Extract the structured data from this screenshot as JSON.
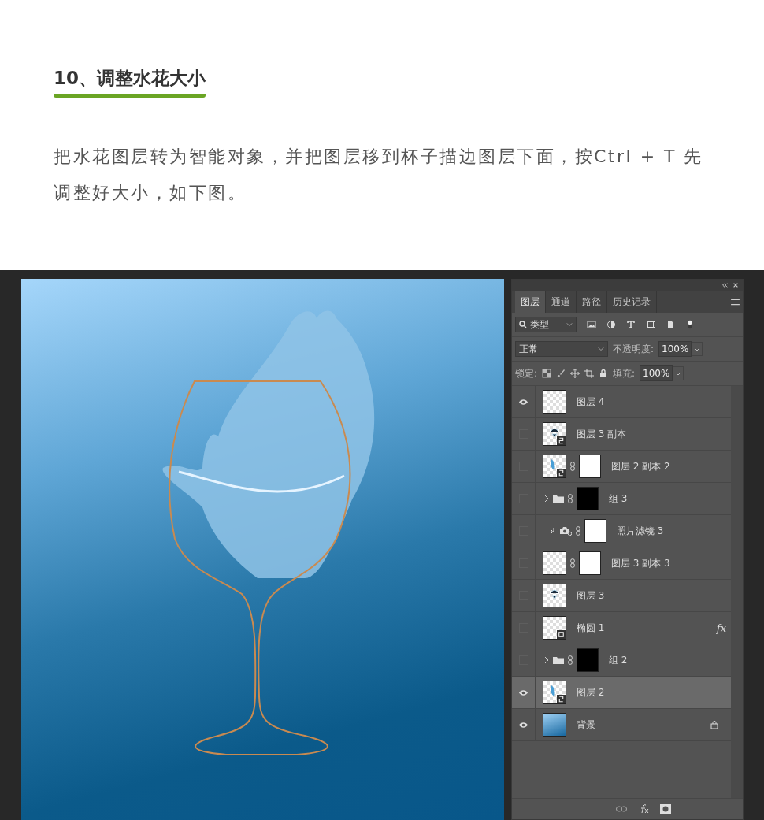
{
  "article": {
    "heading": "10、调整水花大小",
    "paragraph": "把水花图层转为智能对象，并把图层移到杯子描边图层下面，按Ctrl + T 先调整好大小，如下图。"
  },
  "panel": {
    "tabs": [
      {
        "label": "图层",
        "selected": true
      },
      {
        "label": "通道",
        "selected": false
      },
      {
        "label": "路径",
        "selected": false
      },
      {
        "label": "历史记录",
        "selected": false
      }
    ],
    "filter": {
      "value": "类型"
    },
    "blend_mode": {
      "value": "正常"
    },
    "opacity": {
      "label": "不透明度:",
      "value": "100%"
    },
    "lock": {
      "label": "锁定:"
    },
    "fill": {
      "label": "填充:",
      "value": "100%"
    },
    "layers": [
      {
        "name": "图层 4",
        "kind": "layer",
        "thumbnail": {
          "kind": "transparent"
        },
        "visible": true,
        "selected": false
      },
      {
        "name": "图层 3 副本",
        "kind": "layer",
        "thumbnail": {
          "kind": "glass"
        },
        "visible": false,
        "selected": false,
        "smart": true
      },
      {
        "name": "图层 2 副本 2",
        "kind": "layer",
        "thumbnail": {
          "kind": "splash"
        },
        "visible": false,
        "selected": false,
        "smart": true,
        "mask": {
          "kind": "white"
        }
      },
      {
        "name": "组 3",
        "kind": "group",
        "visible": false,
        "selected": false,
        "mask": {
          "kind": "black"
        }
      },
      {
        "name": "照片滤镜 3",
        "kind": "adjustment",
        "visible": false,
        "selected": false,
        "mask": {
          "kind": "white"
        }
      },
      {
        "name": "图层 3 副本 3",
        "kind": "layer",
        "thumbnail": {
          "kind": "transparent"
        },
        "visible": false,
        "selected": false,
        "mask": {
          "kind": "white"
        }
      },
      {
        "name": "图层 3",
        "kind": "layer",
        "thumbnail": {
          "kind": "glass"
        },
        "visible": false,
        "selected": false
      },
      {
        "name": "椭圆 1",
        "kind": "shape",
        "thumbnail": {
          "kind": "transparent"
        },
        "visible": false,
        "selected": false,
        "effects": "fx"
      },
      {
        "name": "组 2",
        "kind": "group",
        "visible": false,
        "selected": false,
        "mask": {
          "kind": "black"
        }
      },
      {
        "name": "图层 2",
        "kind": "layer",
        "thumbnail": {
          "kind": "splash"
        },
        "visible": true,
        "selected": true,
        "smart": true
      },
      {
        "name": "背景",
        "kind": "background",
        "thumbnail": {
          "kind": "gradient"
        },
        "visible": true,
        "selected": false,
        "locked": true
      }
    ]
  }
}
